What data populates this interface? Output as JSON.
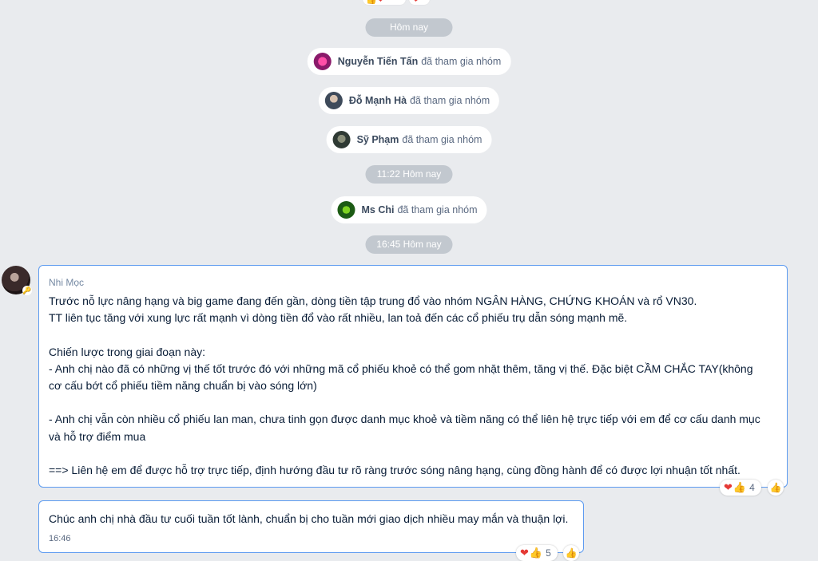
{
  "top_reactions": {
    "count_icon_left": "thumbs-heart",
    "heart_right": "heart"
  },
  "dividers": {
    "today": "Hôm nay",
    "time_1": "11:22 Hôm nay",
    "time_2": "16:45 Hôm nay"
  },
  "joins": [
    {
      "name": "Nguyễn Tiến Tấn",
      "action": "đã tham gia nhóm"
    },
    {
      "name": "Đỗ Mạnh Hà",
      "action": "đã tham gia nhóm"
    },
    {
      "name": "Sỹ Phạm",
      "action": "đã tham gia nhóm"
    },
    {
      "name": "Ms Chi",
      "action": "đã tham gia nhóm"
    }
  ],
  "message1": {
    "sender": "Nhi Mọc",
    "lines": [
      "Trước nỗ lực nâng hạng và big game đang đến gần, dòng tiền tập trung đổ vào nhóm NGÂN HÀNG, CHỨNG KHOÁN và rổ VN30.",
      "TT liên tục tăng với xung lực rất mạnh vì dòng tiền đổ vào rất nhiều, lan toả đến các cổ phiếu trụ dẫn sóng mạnh mẽ.",
      "",
      "Chiến lược trong giai đoạn này:",
      "- Anh chị nào đã có những vị thế tốt trước đó với những mã cổ phiếu khoẻ có thể gom nhặt thêm, tăng vị thế. Đặc biệt CẦM CHẮC TAY(không",
      "cơ cấu bớt cổ phiếu tiềm năng chuẩn bị vào sóng lớn)",
      "",
      "- Anh chị vẫn còn nhiều cổ phiếu lan man, chưa tinh gọn được danh mục khoẻ và tiềm năng có thể liên hệ trực tiếp với em để cơ cấu danh mục",
      "và hỗ trợ điểm mua",
      "",
      "==> Liên hệ em để được hỗ trợ trực tiếp, định hướng đầu tư rõ ràng trước sóng nâng hạng, cùng đồng hành để có được lợi nhuận tốt nhất."
    ],
    "reaction_count": "4"
  },
  "message2": {
    "text": "Chúc anh chị nhà đầu tư cuối tuần tốt lành, chuẩn bị cho tuần mới giao dịch nhiều may mắn và thuận lợi.",
    "time": "16:46",
    "reaction_count": "5"
  },
  "icons": {
    "heart": "heart-icon",
    "thumb": "thumbs-up-icon",
    "like": "like-outline-icon",
    "key": "key-icon"
  },
  "colors": {
    "background": "#e9ebee",
    "pill": "#c2c8cf",
    "bubble_border": "#5d9bf0",
    "text": "#081c36",
    "muted": "#7589a3"
  }
}
